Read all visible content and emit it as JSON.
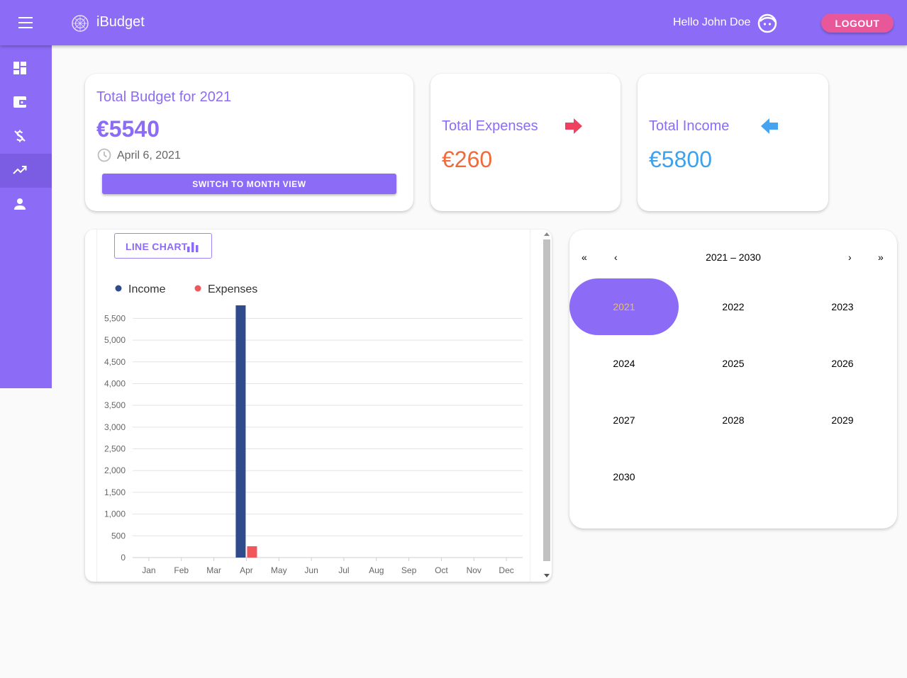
{
  "app": {
    "title": "iBudget"
  },
  "header": {
    "greeting": "Hello John Doe",
    "logout_label": "LOGOUT"
  },
  "sidebar": {
    "items": [
      {
        "icon": "dashboard-icon",
        "active": false
      },
      {
        "icon": "wallet-icon",
        "active": false
      },
      {
        "icon": "money-off-icon",
        "active": false
      },
      {
        "icon": "trending-up-icon",
        "active": true
      },
      {
        "icon": "person-icon",
        "active": false
      }
    ]
  },
  "budget": {
    "title": "Total Budget for 2021",
    "amount": "€5540",
    "date": "April 6, 2021",
    "switch_label": "SWITCH TO MONTH VIEW"
  },
  "expenses": {
    "label": "Total Expenses",
    "amount": "€260",
    "amount_color": "#ef6b39",
    "arrow_color": "#f0405f"
  },
  "income": {
    "label": "Total Income",
    "amount": "€5800",
    "amount_color": "#3ea2ea",
    "arrow_color": "#45a3f0"
  },
  "chart_toggle": {
    "label": "LINE CHART"
  },
  "chart_data": {
    "type": "bar",
    "categories": [
      "Jan",
      "Feb",
      "Mar",
      "Apr",
      "May",
      "Jun",
      "Jul",
      "Aug",
      "Sep",
      "Oct",
      "Nov",
      "Dec"
    ],
    "series": [
      {
        "name": "Income",
        "color": "#2f4b8c",
        "values": [
          0,
          0,
          0,
          5800,
          0,
          0,
          0,
          0,
          0,
          0,
          0,
          0
        ]
      },
      {
        "name": "Expenses",
        "color": "#f0575d",
        "values": [
          0,
          0,
          0,
          260,
          0,
          0,
          0,
          0,
          0,
          0,
          0,
          0
        ]
      }
    ],
    "yticks": [
      "0",
      "500",
      "1,000",
      "1,500",
      "2,000",
      "2,500",
      "3,000",
      "3,500",
      "4,000",
      "4,500",
      "5,000",
      "5,500"
    ],
    "ylim": [
      0,
      5800
    ],
    "grid": true,
    "legend": "top-left"
  },
  "calendar": {
    "range_label": "2021 – 2030",
    "nav": {
      "first": "«",
      "prev": "‹",
      "next": "›",
      "last": "»"
    },
    "years": [
      "2021",
      "2022",
      "2023",
      "2024",
      "2025",
      "2026",
      "2027",
      "2028",
      "2029",
      "2030"
    ],
    "selected": "2021"
  }
}
